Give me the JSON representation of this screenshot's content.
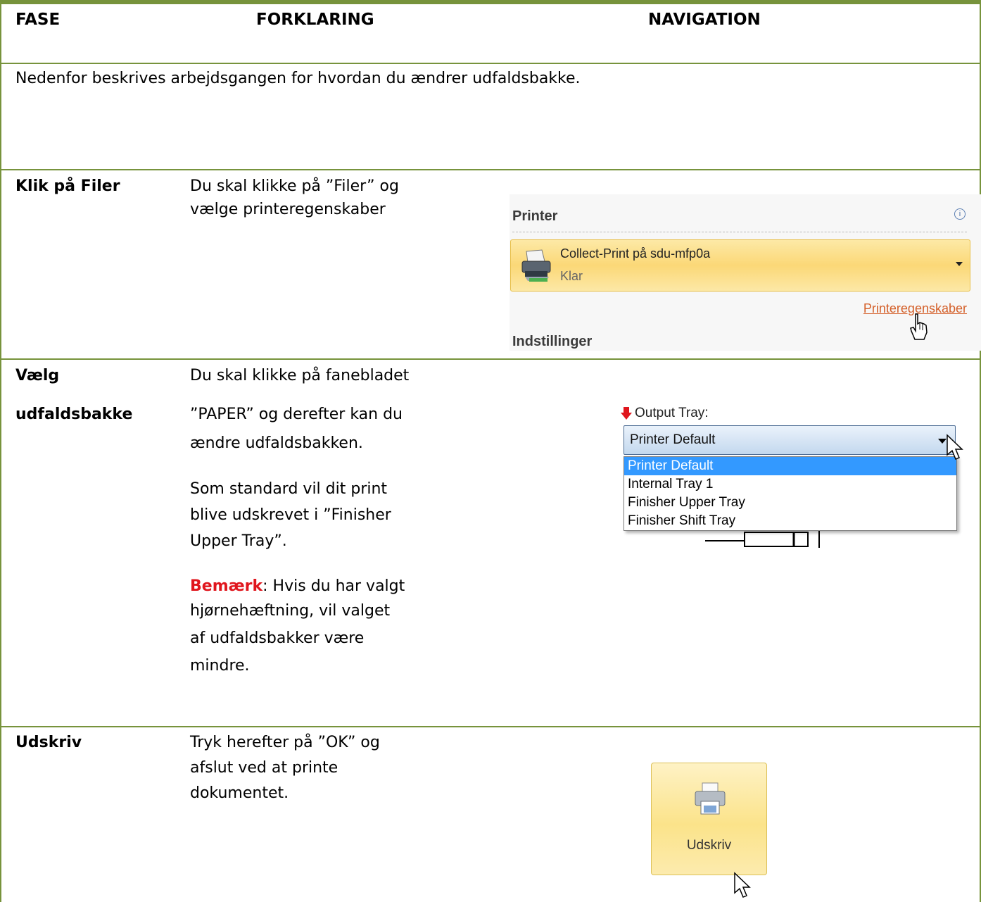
{
  "header": {
    "col_fase": "FASE",
    "col_forklaring": "FORKLARING",
    "col_navigation": "NAVIGATION"
  },
  "intro": "Nedenfor beskrives arbejdsgangen for hvordan du ændrer udfaldsbakke.",
  "rows": [
    {
      "fase": "Klik på Filer",
      "lines": [
        "Du skal klikke på ”Filer” og",
        "vælge printeregenskaber"
      ]
    },
    {
      "fase_lines": [
        "Vælg",
        "udfaldsbakke"
      ],
      "lines": [
        "Du skal klikke på fanebladet",
        "”PAPER” og derefter kan du",
        "ændre udfaldsbakken."
      ],
      "lines2": [
        "Som standard vil dit print",
        "blive udskrevet i  ”Finisher",
        "Upper Tray”."
      ],
      "note_label": "Bemærk",
      "note_first": ": Hvis du har valgt",
      "note_lines": [
        "hjørnehæftning, vil valget",
        "af udfaldsbakker være",
        "mindre."
      ]
    },
    {
      "fase": "Udskriv",
      "lines": [
        "Tryk herefter på ”OK” og",
        "afslut ved at printe",
        "dokumentet."
      ]
    }
  ],
  "screens": {
    "printer": {
      "section_title": "Printer",
      "printer_name": "Collect-Print på sdu-mfp0a",
      "status": "Klar",
      "properties_link": "Printeregenskaber",
      "settings_title": "Indstillinger"
    },
    "tray": {
      "label": "Output Tray:",
      "selected": "Printer Default",
      "options": [
        "Printer Default",
        "Internal Tray 1",
        "Finisher Upper Tray",
        "Finisher Shift Tray"
      ]
    },
    "print_button": {
      "label": "Udskriv"
    }
  },
  "colors": {
    "border": "#77933c",
    "note_red": "#e0161d",
    "link": "#d4602a",
    "highlight": "#3399ff"
  }
}
